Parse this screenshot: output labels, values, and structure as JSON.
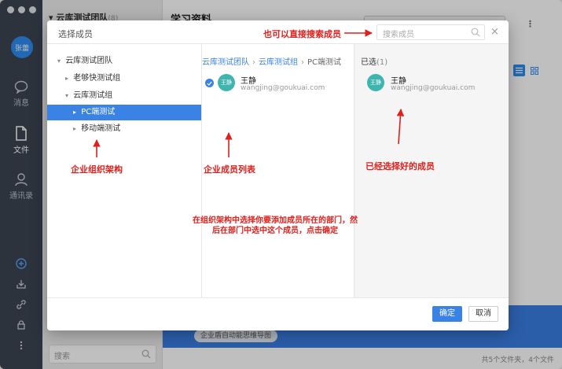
{
  "app": {
    "user_avatar": "张蕾",
    "rail": {
      "messages": "消息",
      "files": "文件",
      "contacts": "通讯录"
    },
    "team_title": "云库测试团队",
    "team_badge": "(8)",
    "main_title": "学习资料",
    "search_placeholder": "搜索",
    "banner_chip": "企业盾自动能思维导图",
    "status": "共5个文件夹，4个文件"
  },
  "modal": {
    "title": "选择成员",
    "search_placeholder": "搜索成员",
    "tree": [
      {
        "label": "云库测试团队",
        "arrow": "▾"
      },
      {
        "label": "老够快测试组",
        "arrow": "▸"
      },
      {
        "label": "云库测试组",
        "arrow": "▾"
      },
      {
        "label": "PC端测试",
        "arrow": "▸"
      },
      {
        "label": "移动端测试",
        "arrow": "▸"
      }
    ],
    "breadcrumb": [
      "云库测试团队",
      "云库测试组",
      "PC端测试"
    ],
    "members": [
      {
        "avatar": "王静",
        "name": "王静",
        "email": "wangjing@goukuai.com",
        "checked": true
      }
    ],
    "selected_label": "已选",
    "selected_count": "(1)",
    "selected": [
      {
        "avatar": "王静",
        "name": "王静",
        "email": "wangjing@goukuai.com"
      }
    ],
    "ok_label": "确定",
    "cancel_label": "取消"
  },
  "annotations": {
    "search_hint": "也可以直接搜索成员",
    "org_structure": "企业组织架构",
    "member_list": "企业成员列表",
    "selected_members": "已经选择好的成员",
    "instructions": "在组织架构中选择你要添加成员所在的部门，然后在部门中选中这个成员，点击确定"
  },
  "colors": {
    "accent": "#3a82e4",
    "annotation": "#e0201d",
    "avatar": "#3fb5b0"
  }
}
